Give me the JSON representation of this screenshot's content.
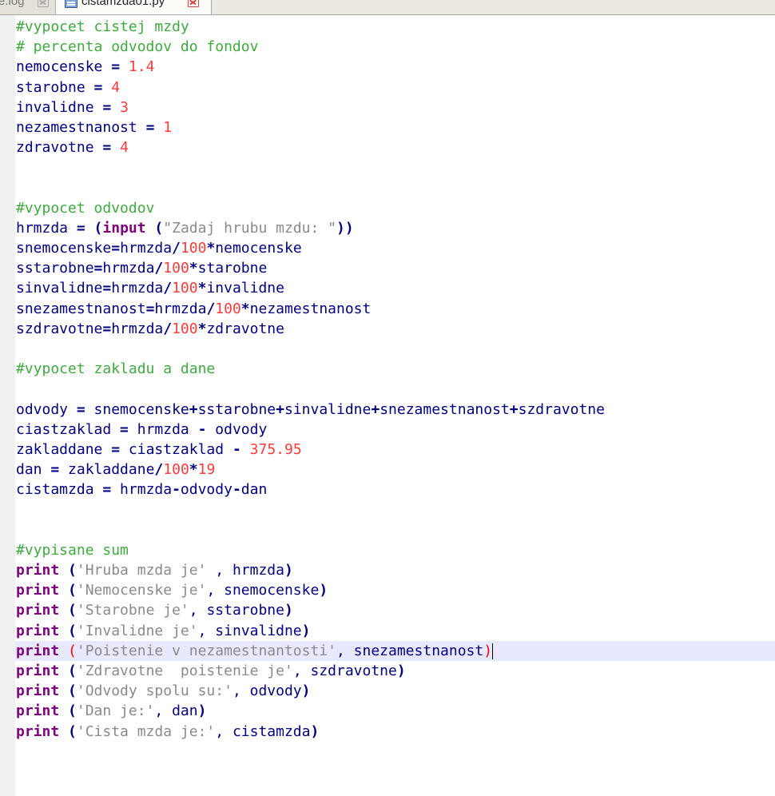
{
  "tabs": [
    {
      "label": "e.log",
      "active": false
    },
    {
      "label": "cistamzda01.py",
      "active": true
    }
  ],
  "colors": {
    "comment": "#3faa3f",
    "number": "#ff3b3b",
    "string": "#8a8a8a",
    "keyword": "#7f007f",
    "default": "#000080",
    "current_line": "#e8e8ff"
  },
  "code": {
    "lines": [
      [
        {
          "t": "#vypocet cistej mzdy",
          "c": "comment"
        }
      ],
      [
        {
          "t": "# percenta odvodov do fondov",
          "c": "comment"
        }
      ],
      [
        {
          "t": "nemocenske ",
          "c": "id"
        },
        {
          "t": "=",
          "c": "op"
        },
        {
          "t": " ",
          "c": "id"
        },
        {
          "t": "1.4",
          "c": "num"
        }
      ],
      [
        {
          "t": "starobne ",
          "c": "id"
        },
        {
          "t": "=",
          "c": "op"
        },
        {
          "t": " ",
          "c": "id"
        },
        {
          "t": "4",
          "c": "num"
        }
      ],
      [
        {
          "t": "invalidne ",
          "c": "id"
        },
        {
          "t": "=",
          "c": "op"
        },
        {
          "t": " ",
          "c": "id"
        },
        {
          "t": "3",
          "c": "num"
        }
      ],
      [
        {
          "t": "nezamestnanost ",
          "c": "id"
        },
        {
          "t": "=",
          "c": "op"
        },
        {
          "t": " ",
          "c": "id"
        },
        {
          "t": "1",
          "c": "num"
        }
      ],
      [
        {
          "t": "zdravotne ",
          "c": "id"
        },
        {
          "t": "=",
          "c": "op"
        },
        {
          "t": " ",
          "c": "id"
        },
        {
          "t": "4",
          "c": "num"
        }
      ],
      [],
      [],
      [
        {
          "t": "#vypocet odvodov",
          "c": "comment"
        }
      ],
      [
        {
          "t": "hrmzda ",
          "c": "id"
        },
        {
          "t": "=",
          "c": "op"
        },
        {
          "t": " ",
          "c": "id"
        },
        {
          "t": "(",
          "c": "op"
        },
        {
          "t": "input",
          "c": "kw"
        },
        {
          "t": " ",
          "c": "id"
        },
        {
          "t": "(",
          "c": "op"
        },
        {
          "t": "\"Zadaj hrubu mzdu: \"",
          "c": "str"
        },
        {
          "t": "))",
          "c": "op"
        }
      ],
      [
        {
          "t": "snemocenske",
          "c": "id"
        },
        {
          "t": "=",
          "c": "op"
        },
        {
          "t": "hrmzda",
          "c": "id"
        },
        {
          "t": "/",
          "c": "op"
        },
        {
          "t": "100",
          "c": "num"
        },
        {
          "t": "*",
          "c": "op"
        },
        {
          "t": "nemocenske",
          "c": "id"
        }
      ],
      [
        {
          "t": "sstarobne",
          "c": "id"
        },
        {
          "t": "=",
          "c": "op"
        },
        {
          "t": "hrmzda",
          "c": "id"
        },
        {
          "t": "/",
          "c": "op"
        },
        {
          "t": "100",
          "c": "num"
        },
        {
          "t": "*",
          "c": "op"
        },
        {
          "t": "starobne",
          "c": "id"
        }
      ],
      [
        {
          "t": "sinvalidne",
          "c": "id"
        },
        {
          "t": "=",
          "c": "op"
        },
        {
          "t": "hrmzda",
          "c": "id"
        },
        {
          "t": "/",
          "c": "op"
        },
        {
          "t": "100",
          "c": "num"
        },
        {
          "t": "*",
          "c": "op"
        },
        {
          "t": "invalidne",
          "c": "id"
        }
      ],
      [
        {
          "t": "snezamestnanost",
          "c": "id"
        },
        {
          "t": "=",
          "c": "op"
        },
        {
          "t": "hrmzda",
          "c": "id"
        },
        {
          "t": "/",
          "c": "op"
        },
        {
          "t": "100",
          "c": "num"
        },
        {
          "t": "*",
          "c": "op"
        },
        {
          "t": "nezamestnanost",
          "c": "id"
        }
      ],
      [
        {
          "t": "szdravotne",
          "c": "id"
        },
        {
          "t": "=",
          "c": "op"
        },
        {
          "t": "hrmzda",
          "c": "id"
        },
        {
          "t": "/",
          "c": "op"
        },
        {
          "t": "100",
          "c": "num"
        },
        {
          "t": "*",
          "c": "op"
        },
        {
          "t": "zdravotne",
          "c": "id"
        }
      ],
      [],
      [
        {
          "t": "#vypocet zakladu a dane",
          "c": "comment"
        }
      ],
      [],
      [
        {
          "t": "odvody ",
          "c": "id"
        },
        {
          "t": "=",
          "c": "op"
        },
        {
          "t": " snemocenske",
          "c": "id"
        },
        {
          "t": "+",
          "c": "op"
        },
        {
          "t": "sstarobne",
          "c": "id"
        },
        {
          "t": "+",
          "c": "op"
        },
        {
          "t": "sinvalidne",
          "c": "id"
        },
        {
          "t": "+",
          "c": "op"
        },
        {
          "t": "snezamestnanost",
          "c": "id"
        },
        {
          "t": "+",
          "c": "op"
        },
        {
          "t": "szdravotne",
          "c": "id"
        }
      ],
      [
        {
          "t": "ciastzaklad ",
          "c": "id"
        },
        {
          "t": "=",
          "c": "op"
        },
        {
          "t": " hrmzda ",
          "c": "id"
        },
        {
          "t": "-",
          "c": "op"
        },
        {
          "t": " odvody",
          "c": "id"
        }
      ],
      [
        {
          "t": "zakladdane ",
          "c": "id"
        },
        {
          "t": "=",
          "c": "op"
        },
        {
          "t": " ciastzaklad ",
          "c": "id"
        },
        {
          "t": "-",
          "c": "op"
        },
        {
          "t": " ",
          "c": "id"
        },
        {
          "t": "375.95",
          "c": "num"
        }
      ],
      [
        {
          "t": "dan ",
          "c": "id"
        },
        {
          "t": "=",
          "c": "op"
        },
        {
          "t": " zakladdane",
          "c": "id"
        },
        {
          "t": "/",
          "c": "op"
        },
        {
          "t": "100",
          "c": "num"
        },
        {
          "t": "*",
          "c": "op"
        },
        {
          "t": "19",
          "c": "num"
        }
      ],
      [
        {
          "t": "cistamzda ",
          "c": "id"
        },
        {
          "t": "=",
          "c": "op"
        },
        {
          "t": " hrmzda",
          "c": "id"
        },
        {
          "t": "-",
          "c": "op"
        },
        {
          "t": "odvody",
          "c": "id"
        },
        {
          "t": "-",
          "c": "op"
        },
        {
          "t": "dan",
          "c": "id"
        }
      ],
      [],
      [],
      [
        {
          "t": "#vypisane sum",
          "c": "comment"
        }
      ],
      [
        {
          "t": "print",
          "c": "kw"
        },
        {
          "t": " ",
          "c": "id"
        },
        {
          "t": "(",
          "c": "op"
        },
        {
          "t": "'Hruba mzda je'",
          "c": "str"
        },
        {
          "t": " , hrmzda",
          "c": "id"
        },
        {
          "t": ")",
          "c": "op"
        }
      ],
      [
        {
          "t": "print",
          "c": "kw"
        },
        {
          "t": " ",
          "c": "id"
        },
        {
          "t": "(",
          "c": "op"
        },
        {
          "t": "'Nemocenske je'",
          "c": "str"
        },
        {
          "t": ", snemocenske",
          "c": "id"
        },
        {
          "t": ")",
          "c": "op"
        }
      ],
      [
        {
          "t": "print",
          "c": "kw"
        },
        {
          "t": " ",
          "c": "id"
        },
        {
          "t": "(",
          "c": "op"
        },
        {
          "t": "'Starobne je'",
          "c": "str"
        },
        {
          "t": ", sstarobne",
          "c": "id"
        },
        {
          "t": ")",
          "c": "op"
        }
      ],
      [
        {
          "t": "print",
          "c": "kw"
        },
        {
          "t": " ",
          "c": "id"
        },
        {
          "t": "(",
          "c": "op"
        },
        {
          "t": "'Invalidne je'",
          "c": "str"
        },
        {
          "t": ", sinvalidne",
          "c": "id"
        },
        {
          "t": ")",
          "c": "op"
        }
      ],
      [
        {
          "t": "print",
          "c": "kw"
        },
        {
          "t": " ",
          "c": "id"
        },
        {
          "t": "(",
          "c": "brace"
        },
        {
          "t": "'Poistenie v nezamestnantosti'",
          "c": "str"
        },
        {
          "t": ", snezamestnanost",
          "c": "id"
        },
        {
          "t": ")",
          "c": "brace"
        }
      ],
      [
        {
          "t": "print",
          "c": "kw"
        },
        {
          "t": " ",
          "c": "id"
        },
        {
          "t": "(",
          "c": "op"
        },
        {
          "t": "'Zdravotne  poistenie je'",
          "c": "str"
        },
        {
          "t": ", szdravotne",
          "c": "id"
        },
        {
          "t": ")",
          "c": "op"
        }
      ],
      [
        {
          "t": "print",
          "c": "kw"
        },
        {
          "t": " ",
          "c": "id"
        },
        {
          "t": "(",
          "c": "op"
        },
        {
          "t": "'Odvody spolu su:'",
          "c": "str"
        },
        {
          "t": ", odvody",
          "c": "id"
        },
        {
          "t": ")",
          "c": "op"
        }
      ],
      [
        {
          "t": "print",
          "c": "kw"
        },
        {
          "t": " ",
          "c": "id"
        },
        {
          "t": "(",
          "c": "op"
        },
        {
          "t": "'Dan je:'",
          "c": "str"
        },
        {
          "t": ", dan",
          "c": "id"
        },
        {
          "t": ")",
          "c": "op"
        }
      ],
      [
        {
          "t": "print",
          "c": "kw"
        },
        {
          "t": " ",
          "c": "id"
        },
        {
          "t": "(",
          "c": "op"
        },
        {
          "t": "'Cista mzda je:'",
          "c": "str"
        },
        {
          "t": ", cistamzda",
          "c": "id"
        },
        {
          "t": ")",
          "c": "op"
        }
      ]
    ],
    "current_line": 31
  }
}
